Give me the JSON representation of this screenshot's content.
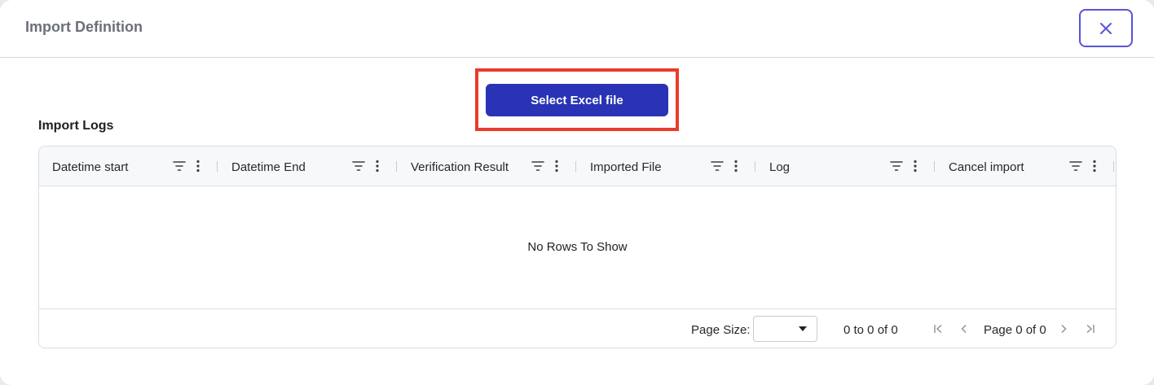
{
  "dialog": {
    "title": "Import Definition",
    "close_icon": "close-icon"
  },
  "actions": {
    "select_file_label": "Select Excel file"
  },
  "import_logs": {
    "title": "Import Logs",
    "columns": [
      "Datetime start",
      "Datetime End",
      "Verification Result",
      "Imported File",
      "Log",
      "Cancel import"
    ],
    "empty_message": "No Rows To Show",
    "pagination": {
      "page_size_label": "Page Size:",
      "page_size_value": "",
      "row_summary": "0 to 0 of 0",
      "page_text": "Page 0 of 0"
    }
  },
  "colors": {
    "primary": "#2a33b5",
    "highlight": "#ea3b2c",
    "close_border": "#5b53d6"
  }
}
